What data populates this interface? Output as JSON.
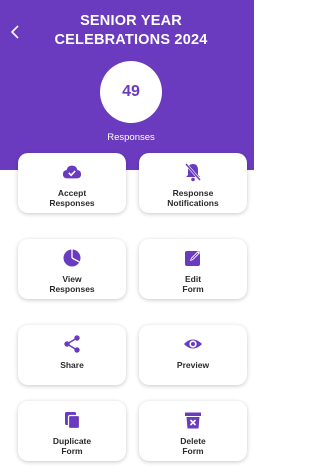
{
  "header": {
    "title_line1": "SENIOR YEAR",
    "title_line2": "CELEBRATIONS 2024",
    "back_icon": "chevron-left-icon",
    "response_count": "49",
    "response_label": "Responses",
    "background_color": "#6b3bbf"
  },
  "actions": [
    {
      "label": "Accept\nResponses",
      "icon": "cloud-check-icon"
    },
    {
      "label": "Response\nNotifications",
      "icon": "bell-off-icon"
    },
    {
      "label": "View\nResponses",
      "icon": "pie-chart-icon"
    },
    {
      "label": "Edit\nForm",
      "icon": "edit-icon"
    },
    {
      "label": "Share",
      "icon": "share-icon"
    },
    {
      "label": "Preview",
      "icon": "eye-icon"
    },
    {
      "label": "Duplicate\nForm",
      "icon": "duplicate-icon"
    },
    {
      "label": "Delete\nForm",
      "icon": "delete-icon"
    }
  ],
  "accent_color": "#6b3bbf"
}
